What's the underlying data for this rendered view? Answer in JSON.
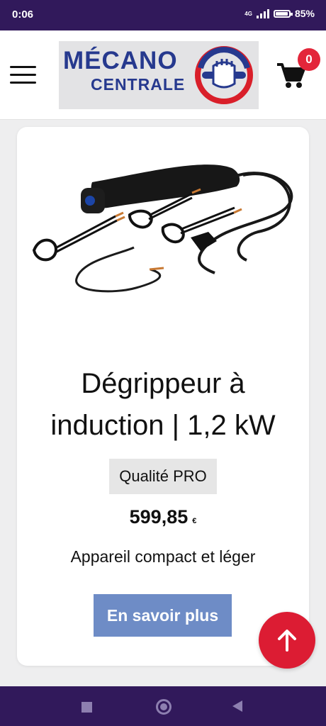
{
  "status_bar": {
    "time": "0:06",
    "network": "4G",
    "battery": "85%"
  },
  "header": {
    "logo_line1": "MÉCANO",
    "logo_line2": "CENTRALE",
    "cart_count": "0"
  },
  "product": {
    "title_line1": "Dégrippeur à",
    "title_line2": "induction | 1,2 kW",
    "badge": "Qualité PRO",
    "price": "599,85",
    "currency": "€",
    "description": "Appareil compact et léger",
    "cta": "En savoir plus"
  },
  "colors": {
    "status_bar": "#31195b",
    "brand_blue": "#26398e",
    "accent_red": "#dc1c33",
    "button": "#6e8cc6"
  },
  "icons": {
    "menu": "menu-icon",
    "cart": "cart-icon",
    "scroll_top": "arrow-up-icon"
  }
}
